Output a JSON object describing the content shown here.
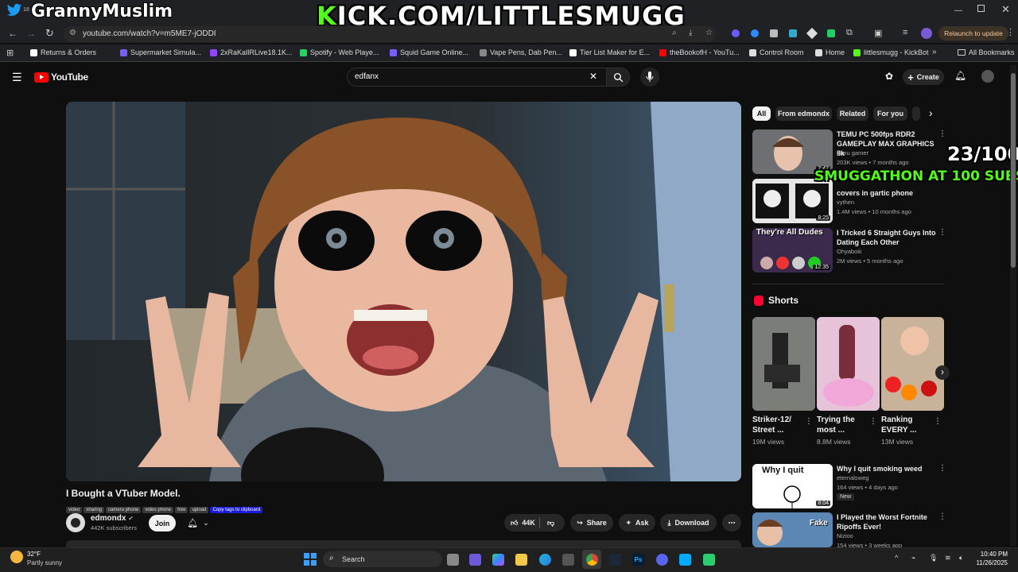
{
  "overlay": {
    "twitter_handle": "GrannyMuslim",
    "tab_fragment": "18",
    "kick_url": "KICK.COM/LITTLESMUGG",
    "sub_goal": "23/100",
    "smuggathon": "SMUGGATHON AT 100 SUBS!"
  },
  "browser": {
    "url": "youtube.com/watch?v=m5ME7-jODDI",
    "relaunch_label": "Relaunch to update",
    "bookmarks": [
      {
        "label": "Returns & Orders",
        "color": "#ffffff"
      },
      {
        "label": "Supermarket Simula...",
        "color": "#7b5cff"
      },
      {
        "label": "2xRaKaIlRLive18.1K...",
        "color": "#9146ff"
      },
      {
        "label": "Spotify - Web Playe...",
        "color": "#1ed760"
      },
      {
        "label": "Squid Game Online...",
        "color": "#7b5cff"
      },
      {
        "label": "Vape Pens, Dab Pen...",
        "color": "#888888"
      },
      {
        "label": "Tier List Maker for E...",
        "color": "#ffffff"
      },
      {
        "label": "theBookofH - YouTu...",
        "color": "#ff0000"
      },
      {
        "label": "Control Room",
        "color": "#dddddd"
      },
      {
        "label": "Home",
        "color": "#dddddd"
      },
      {
        "label": "littlesmugg - KickBot",
        "color": "#53fc18"
      }
    ],
    "all_bookmarks": "All Bookmarks"
  },
  "youtube": {
    "logo_text": "YouTube",
    "search_value": "edfanx",
    "create_label": "Create",
    "chips": [
      "All",
      "From edmondx",
      "Related",
      "For you"
    ],
    "video": {
      "title": "I Bought a VTuber Model.",
      "tags": [
        "video",
        "sharing",
        "camera phone",
        "video phone",
        "free",
        "upload"
      ],
      "copy_tags": "Copy tags to clipboard",
      "channel": "edmondx",
      "subscribers": "442K subscribers",
      "join_label": "Join",
      "likes": "44K",
      "share_label": "Share",
      "ask_label": "Ask",
      "download_label": "Download"
    },
    "related": [
      {
        "title_l1": "TEMU PC 500fps RDR2",
        "title_l2": "GAMEPLAY MAX GRAPHICS 8k",
        "channel": "temu gamer",
        "meta": "203K views • 7 months ago",
        "duration": "2:42"
      },
      {
        "title_l1": "",
        "title_l2": "covers in gartic phone",
        "channel": "vythen",
        "meta": "1.4M views • 10 months ago",
        "duration": "8:25"
      },
      {
        "title_l1": "I Tricked 6 Straight Guys Into",
        "title_l2": "Dating Each Other",
        "channel": "Ohyaboiii",
        "meta": "2M views • 5 months ago",
        "duration": "12:35",
        "thumb_text": "They're All Dudes"
      },
      {
        "title_l1": "Why I quit smoking weed",
        "title_l2": "",
        "channel": "eternalsweg",
        "meta": "164 views • 4 days ago",
        "duration": "8:04",
        "badge": "New",
        "thumb_text": "Why I quit"
      },
      {
        "title_l1": "I Played the Worst Fortnite",
        "title_l2": "Ripoffs Ever!",
        "channel": "Nizioo",
        "meta": "154 views • 3 weeks ago",
        "duration": "",
        "thumb_text": "Fake"
      }
    ],
    "shorts_label": "Shorts",
    "shorts": [
      {
        "title_l1": "Striker-12/",
        "title_l2": "Street ...",
        "views": "19M views"
      },
      {
        "title_l1": "Trying the",
        "title_l2": "most ...",
        "views": "8.8M views"
      },
      {
        "title_l1": "Ranking",
        "title_l2": "EVERY ...",
        "views": "13M views"
      }
    ]
  },
  "taskbar": {
    "temp": "32°F",
    "weather": "Partly sunny",
    "search_label": "Search",
    "time": "10:40 PM",
    "date": "11/26/2025"
  }
}
